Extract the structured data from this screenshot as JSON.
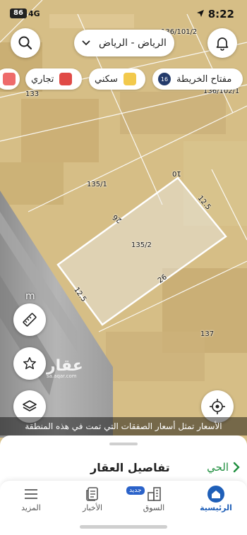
{
  "status_bar": {
    "time": "8:22",
    "network": "4G",
    "battery": "86"
  },
  "header": {
    "city": "الرياض - الرياض"
  },
  "legend": {
    "map_key_label": "مفتاح الخريطة",
    "map_key_count": "16",
    "residential_label": "سكني",
    "residential_color": "#f2c94c",
    "commercial_label": "تجاري",
    "commercial_color": "#e04a46",
    "partial_color": "#ee6b6b"
  },
  "map": {
    "lots": [
      {
        "number": "136/101/2"
      },
      {
        "number": "136/102/1"
      },
      {
        "number": "133"
      },
      {
        "number": "135/1"
      },
      {
        "number": "135/2"
      },
      {
        "number": "137"
      }
    ],
    "dimensions": {
      "top": "10",
      "right": "12.5",
      "north": "26",
      "south": "26",
      "west": "12.5",
      "street": "m"
    },
    "watermark_ar": "عقار",
    "watermark_en": "sa.aqar.com",
    "notice": "الأسعار تمثل أسعار الصفقات التي تمت في هذه المنطقة"
  },
  "sheet": {
    "title": "تفاصيل العقار",
    "back_label": "الحي"
  },
  "tabs": {
    "home": "الرئيسية",
    "market": "السوق",
    "new_badge": "جديد",
    "news": "الأخبار",
    "more": "المزيد"
  },
  "colors": {
    "accent": "#1f5fb8",
    "green": "#1e8e3e",
    "parcel_outline": "#ffffff"
  }
}
